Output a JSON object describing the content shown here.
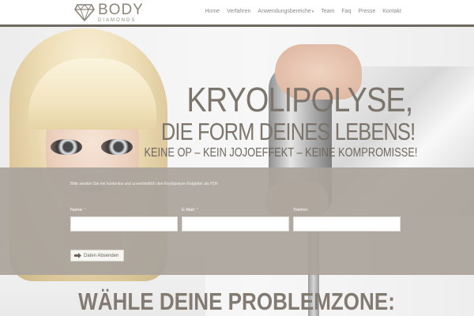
{
  "logo": {
    "name": "BODY",
    "tagline": "DIAMONDS"
  },
  "nav": {
    "items": [
      {
        "label": "Home"
      },
      {
        "label": "Verfahren"
      },
      {
        "label": "Anwendungsbereiche"
      },
      {
        "label": "Team"
      },
      {
        "label": "Faq"
      },
      {
        "label": "Presse"
      },
      {
        "label": "Kontakt"
      }
    ]
  },
  "hero": {
    "title": "KRYOLIPOLYSE,",
    "subtitle": "DIE FORM DEINES LEBENS!",
    "tagline": "KEINE OP – KEIN JOJOEFFEKT – KEINE KOMPROMISSE!"
  },
  "form": {
    "intro": "Bitte senden Sie mir kostenlos und unverbindlich den Kryolipolyse Ratgeber als PDF",
    "name_label": "Name:",
    "email_label": "E-Mail:",
    "phone_label": "Telefon:",
    "required_mark": "*",
    "name_value": "",
    "email_value": "",
    "phone_value": "",
    "submit_label": "Daten Absenden"
  },
  "section": {
    "heading": "WÄHLE DEINE PROBLEMZONE:"
  },
  "colors": {
    "accent": "#7c756c",
    "overlay": "#aaa49c",
    "header_line": "#6e6860"
  }
}
